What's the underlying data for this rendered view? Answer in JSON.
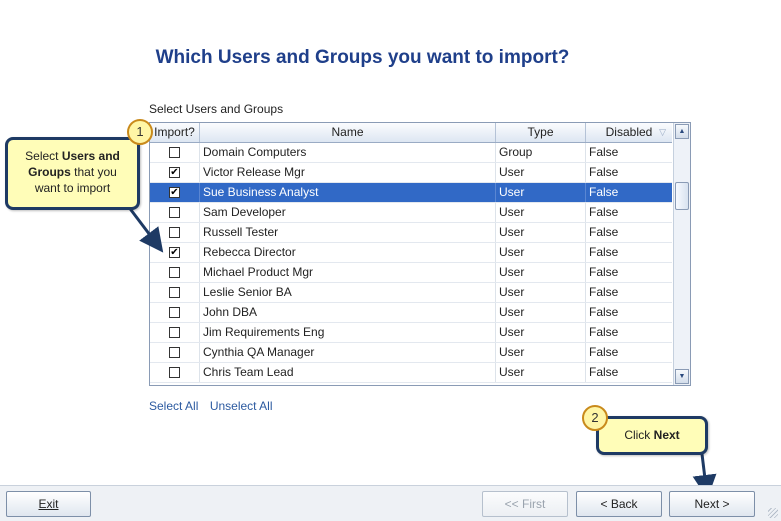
{
  "title": "Which Users and Groups you want to import?",
  "grid_caption": "Select Users and Groups",
  "columns": {
    "import": "Import?",
    "name": "Name",
    "type": "Type",
    "disabled": "Disabled"
  },
  "rows": [
    {
      "checked": false,
      "name": "Domain Computers",
      "type": "Group",
      "disabled": "False",
      "selected": false
    },
    {
      "checked": true,
      "name": "Victor Release Mgr",
      "type": "User",
      "disabled": "False",
      "selected": false
    },
    {
      "checked": true,
      "name": "Sue Business Analyst",
      "type": "User",
      "disabled": "False",
      "selected": true
    },
    {
      "checked": false,
      "name": "Sam Developer",
      "type": "User",
      "disabled": "False",
      "selected": false
    },
    {
      "checked": false,
      "name": "Russell Tester",
      "type": "User",
      "disabled": "False",
      "selected": false
    },
    {
      "checked": true,
      "name": "Rebecca Director",
      "type": "User",
      "disabled": "False",
      "selected": false
    },
    {
      "checked": false,
      "name": "Michael Product Mgr",
      "type": "User",
      "disabled": "False",
      "selected": false
    },
    {
      "checked": false,
      "name": "Leslie Senior BA",
      "type": "User",
      "disabled": "False",
      "selected": false
    },
    {
      "checked": false,
      "name": "John DBA",
      "type": "User",
      "disabled": "False",
      "selected": false
    },
    {
      "checked": false,
      "name": "Jim Requirements Eng",
      "type": "User",
      "disabled": "False",
      "selected": false
    },
    {
      "checked": false,
      "name": "Cynthia QA Manager",
      "type": "User",
      "disabled": "False",
      "selected": false
    },
    {
      "checked": false,
      "name": "Chris Team Lead",
      "type": "User",
      "disabled": "False",
      "selected": false
    }
  ],
  "links": {
    "select_all": "Select All",
    "unselect_all": "Unselect All"
  },
  "callout1": {
    "badge": "1",
    "pre": "Select ",
    "bold": "Users and Groups",
    "post": " that you want to import"
  },
  "callout2": {
    "badge": "2",
    "pre": "Click ",
    "bold": "Next"
  },
  "buttons": {
    "exit": "Exit",
    "first": "<< First",
    "back": "< Back",
    "next": "Next >"
  },
  "icons": {
    "sort": "funnel-icon",
    "scroll_up": "arrow-up-icon",
    "scroll_down": "arrow-down-icon"
  },
  "colors": {
    "title": "#1f3f8a",
    "selection": "#3169c6",
    "callout_bg": "#fffdb8",
    "callout_border": "#1e3a64"
  }
}
